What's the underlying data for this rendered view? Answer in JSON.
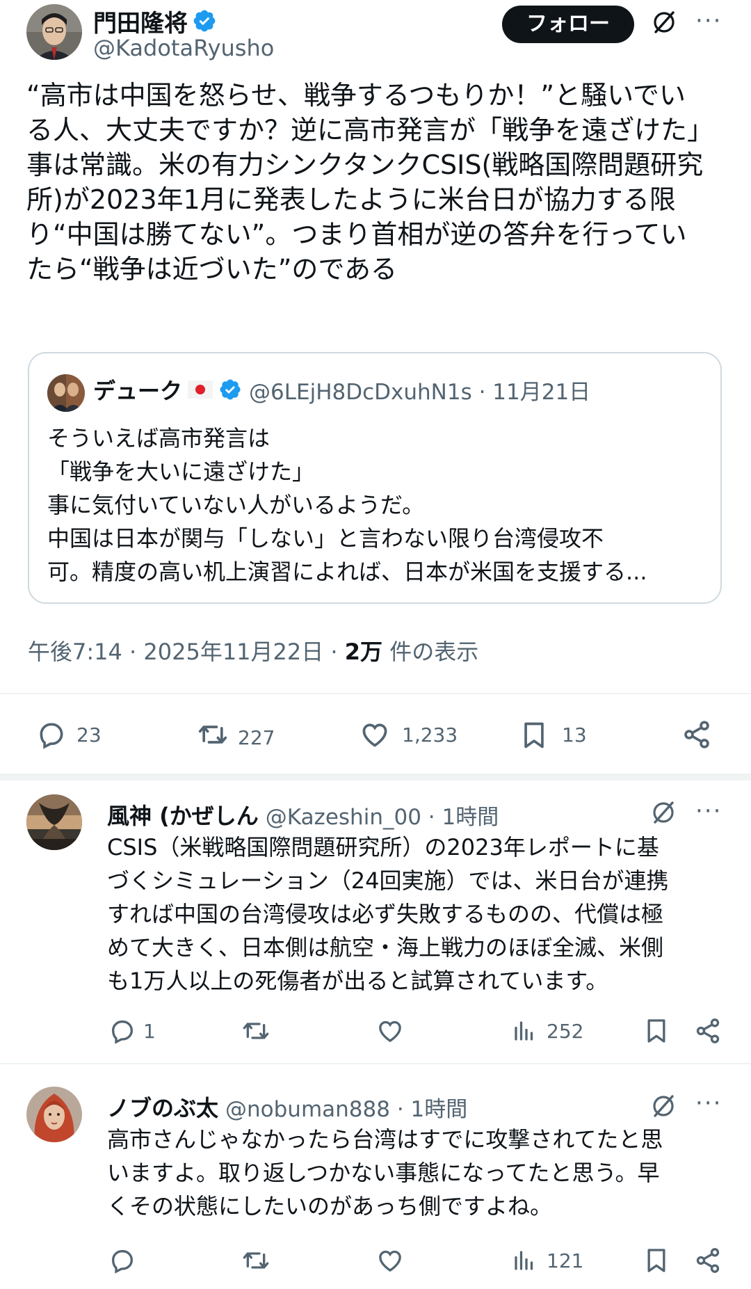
{
  "tweet": {
    "author_name": "門田隆将",
    "author_handle": "@KadotaRyusho",
    "follow_label": "フォロー",
    "more_label": "···",
    "text_lines": [
      "“高市は中国を怒らせ、戦争するつもりか！”と騒いでい",
      "る人、大丈夫ですか？逆に高市発言が「戦争を遠ざけた」",
      "事は常識。米の有力シンクタンクCSIS(戦略国際問題研究",
      "所)が2023年1月に発表したように米台日が協力する限",
      "り“中国は勝てない”。つまり首相が逆の答弁を行ってい",
      "たら“戦争は近づいた”のである"
    ],
    "timestamp": "午後7:14 · 2025年11月22日 · ",
    "views_count": "2万",
    "views_label": " 件の表示",
    "stats": {
      "replies": "23",
      "retweets": "227",
      "likes": "1,233",
      "bookmarks": "13"
    }
  },
  "quote": {
    "author_name": "デューク",
    "flag": "🇯🇵",
    "handle_date": "@6LEjH8DcDxuhN1s · 11月21日",
    "text_lines": [
      "そういえば高市発言は",
      "「戦争を大いに遠ざけた」",
      "事に気付いていない人がいるようだ。",
      "中国は日本が関与「しない」と言わない限り台湾侵攻不",
      "可。精度の高い机上演習によれば、日本が米国を支援する..."
    ]
  },
  "replies": [
    {
      "author_name": "風神 (かぜしん",
      "handle_time": "@Kazeshin_00 · 1時間",
      "text_lines": [
        "CSIS（米戦略国際問題研究所）の2023年レポートに基",
        "づくシミュレーション（24回実施）では、米日台が連携",
        "すれば中国の台湾侵攻は必ず失敗するものの、代償は極",
        "めて大きく、日本側は航空・海上戦力のほぼ全滅、米側",
        "も1万人以上の死傷者が出ると試算されています。"
      ],
      "stats": {
        "replies": "1",
        "views": "252"
      }
    },
    {
      "author_name": "ノブのぶ太",
      "handle_time": "@nobuman888 · 1時間",
      "text_lines": [
        "高市さんじゃなかったら台湾はすでに攻撃されてたと思",
        "いますよ。取り返しつかない事態になってたと思う。早",
        "くその状態にしたいのがあっち側ですよね。"
      ],
      "stats": {
        "views": "121"
      }
    }
  ],
  "colors": {
    "verified": "#1d9bf0",
    "text": "#0f1419",
    "muted": "#536471",
    "border": "#cfd9de"
  },
  "icons": [
    "verified-badge-icon",
    "grok-icon",
    "more-icon",
    "reply-icon",
    "retweet-icon",
    "like-icon",
    "bookmark-icon",
    "share-icon",
    "views-icon"
  ]
}
